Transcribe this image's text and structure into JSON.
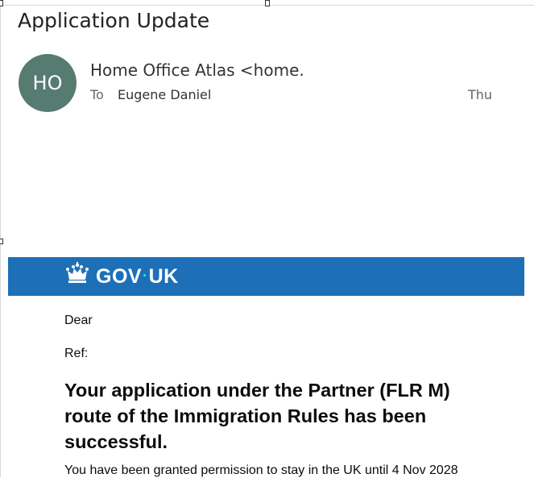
{
  "email": {
    "subject": "Application Update",
    "avatar_initials": "HO",
    "avatar_color": "#567b71",
    "sender": "Home Office Atlas <home.o",
    "to_label": "To",
    "recipient": "Eugene Daniel",
    "date": "Thu"
  },
  "banner": {
    "brand_left": "GOV",
    "brand_dot": "·",
    "brand_right": "UK",
    "background_color": "#1d70b8",
    "icon": "crown-icon"
  },
  "body": {
    "greeting": "Dear",
    "ref_label": "Ref:",
    "headline": "Your application under the Partner (FLR M) route of the Immigration Rules has been successful.",
    "granted_text": "You have been granted permission to stay in the UK until 4 Nov 2028"
  }
}
